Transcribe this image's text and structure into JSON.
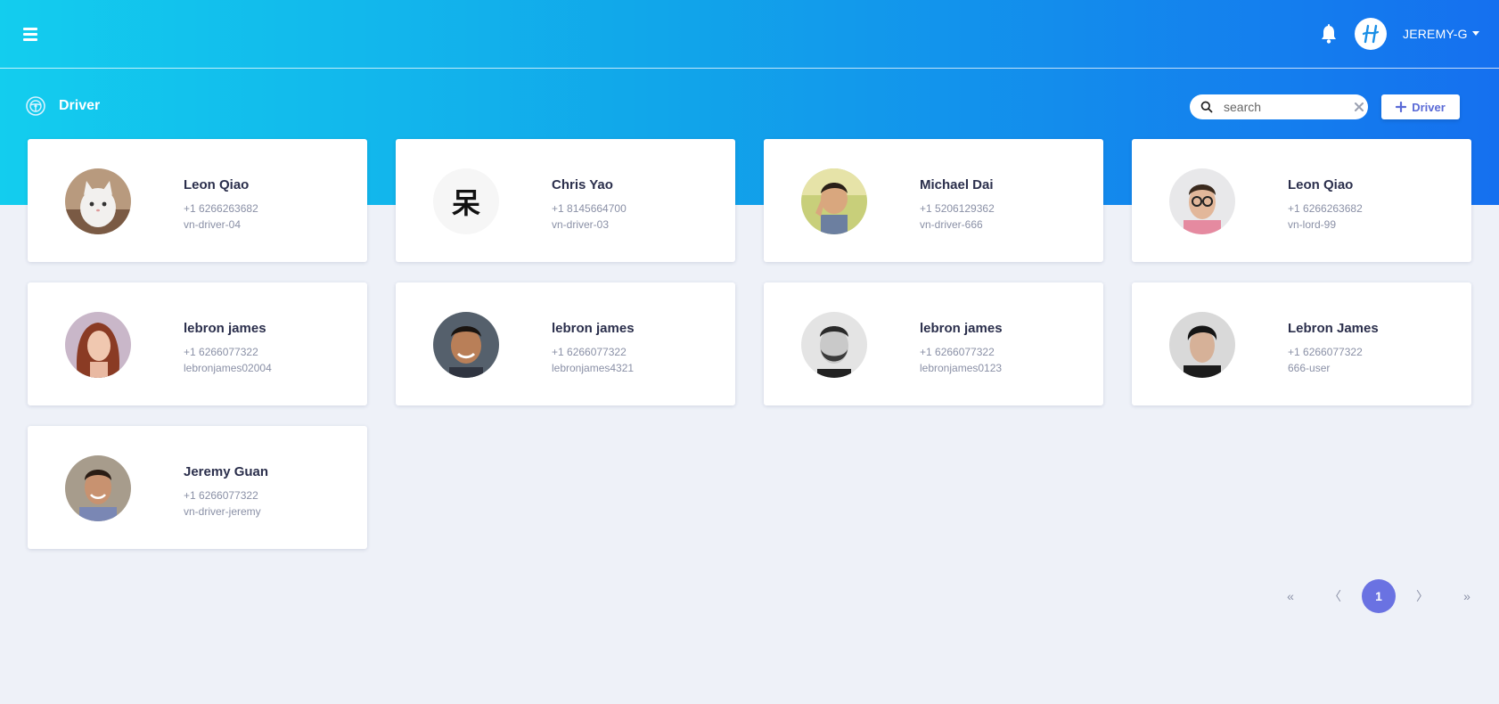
{
  "header": {
    "user_label": "JEREMY-G",
    "icons": [
      "menu-icon",
      "bell-icon",
      "logo-avatar",
      "caret-down-icon"
    ]
  },
  "page": {
    "title": "Driver",
    "icon": "steering-wheel-icon"
  },
  "search": {
    "placeholder": "search",
    "value": ""
  },
  "add_button": {
    "label": "Driver",
    "icon": "plus-icon"
  },
  "drivers": [
    {
      "name": "Leon Qiao",
      "phone": "+1 6266263682",
      "username": "vn-driver-04"
    },
    {
      "name": "Chris Yao",
      "phone": "+1 8145664700",
      "username": "vn-driver-03",
      "avatar_text": "呆"
    },
    {
      "name": "Michael Dai",
      "phone": "+1 5206129362",
      "username": "vn-driver-666"
    },
    {
      "name": "Leon Qiao",
      "phone": "+1 6266263682",
      "username": "vn-lord-99"
    },
    {
      "name": "lebron james",
      "phone": "+1 6266077322",
      "username": "lebronjames02004"
    },
    {
      "name": "lebron james",
      "phone": "+1 6266077322",
      "username": "lebronjames4321"
    },
    {
      "name": "lebron james",
      "phone": "+1 6266077322",
      "username": "lebronjames0123"
    },
    {
      "name": "Lebron James",
      "phone": "+1 6266077322",
      "username": "666-user"
    },
    {
      "name": "Jeremy Guan",
      "phone": "+1 6266077322",
      "username": "vn-driver-jeremy"
    }
  ],
  "pagination": {
    "first": "«",
    "prev": "〈",
    "current": "1",
    "next": "〉",
    "last": "»"
  },
  "colors": {
    "accent": "#6a72e2",
    "header_gradient_start": "#13cdee",
    "header_gradient_end": "#1570ef",
    "background": "#eef1f8",
    "name_text": "#2b2f4c",
    "meta_text": "#8a90a6"
  }
}
